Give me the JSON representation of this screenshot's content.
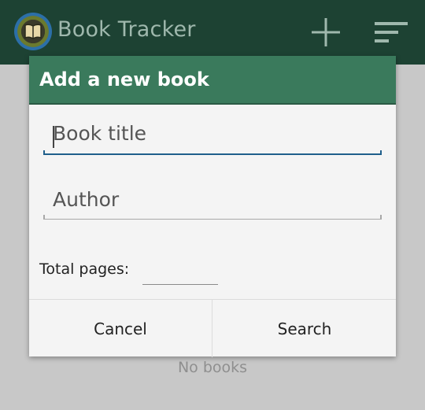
{
  "app": {
    "title": "Book Tracker",
    "empty_message": "No books"
  },
  "action_bar": {
    "icons": [
      "book-icon",
      "plus-icon",
      "sort-icon"
    ]
  },
  "dialog": {
    "title": "Add a new book",
    "fields": {
      "title": {
        "placeholder": "Book title",
        "value": ""
      },
      "author": {
        "placeholder": "Author",
        "value": ""
      }
    },
    "pages_label": "Total pages:",
    "pages_value": "",
    "buttons": {
      "cancel": "Cancel",
      "search": "Search"
    }
  },
  "colors": {
    "action_bar": "#1d4233",
    "dialog_header": "#3a7a5c",
    "focus_underline": "#1f5f8b"
  }
}
